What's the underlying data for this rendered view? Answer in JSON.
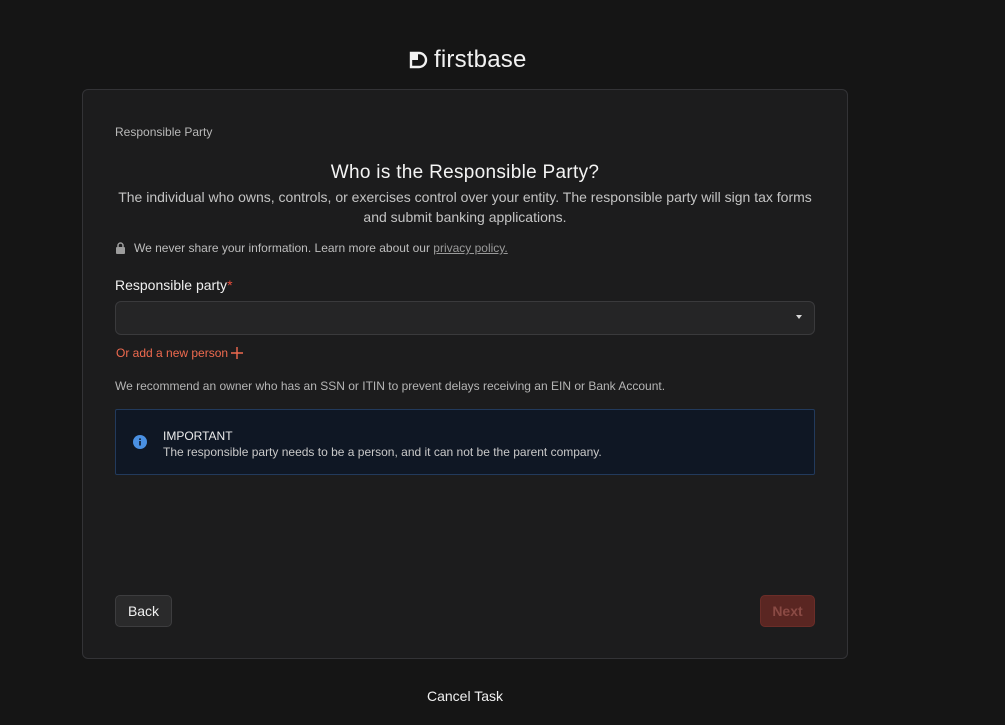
{
  "brand": {
    "name": "firstbase",
    "logo_icon": "firstbase-logo-icon"
  },
  "card": {
    "step_label": "Responsible Party",
    "heading": "Who is the Responsible Party?",
    "subtitle": "The individual who owns, controls, or exercises control over your entity. The responsible party will sign tax forms and submit banking applications.",
    "privacy": {
      "icon": "lock-icon",
      "text": "We never share your information. Learn more about our ",
      "link_text": "privacy policy."
    },
    "field": {
      "label": "Responsible party",
      "required_mark": "*",
      "selected_value": ""
    },
    "add_person": {
      "label": "Or add a new person",
      "icon": "plus-icon"
    },
    "recommendation": "We recommend an owner who has an SSN or ITIN to prevent delays receiving an EIN or Bank Account.",
    "notice": {
      "icon": "info-icon",
      "title": "IMPORTANT",
      "body": "The responsible party needs to be a person, and it can not be the parent company."
    },
    "back_label": "Back",
    "next_label": "Next"
  },
  "footer": {
    "cancel_label": "Cancel Task"
  },
  "colors": {
    "background": "#151515",
    "card": "#1c1c1d",
    "accent": "#ef6a4f",
    "info": "#4a90e2",
    "next_disabled": "#5a2622"
  }
}
